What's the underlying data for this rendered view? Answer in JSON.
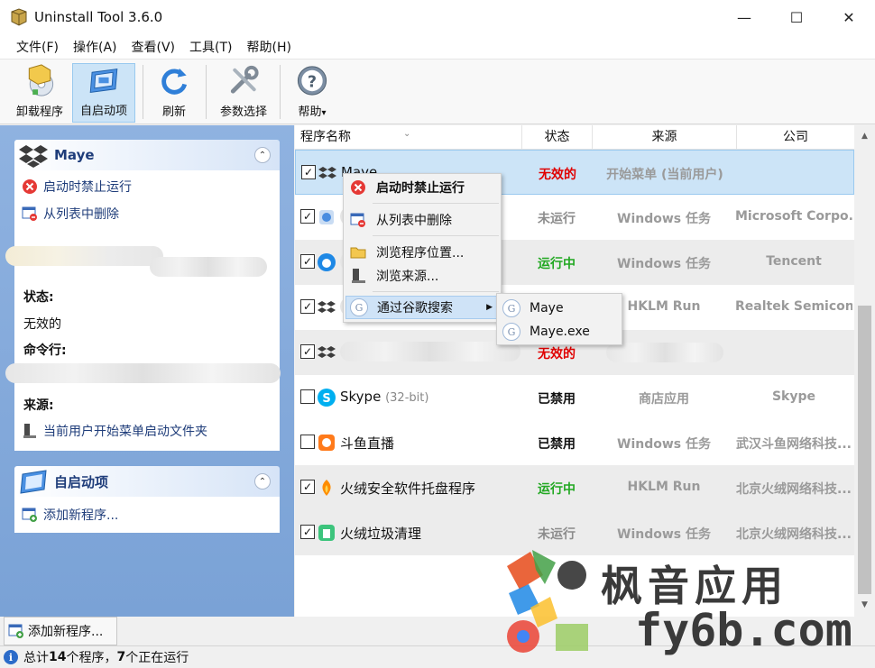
{
  "window": {
    "title": "Uninstall Tool 3.6.0",
    "minimize": "—",
    "maximize": "☐",
    "close": "✕"
  },
  "menu": [
    "文件(F)",
    "操作(A)",
    "查看(V)",
    "工具(T)",
    "帮助(H)"
  ],
  "toolbar": {
    "uninstall": "卸载程序",
    "autostart": "自启动项",
    "refresh": "刷新",
    "preferences": "参数选择",
    "help": "帮助",
    "help_arrow": "▾"
  },
  "left_panel": {
    "item_title": "Maye",
    "actions": {
      "disable_on_start": "启动时禁止运行",
      "remove_from_list": "从列表中删除"
    },
    "status_label": "状态:",
    "status_value": "无效的",
    "cmdline_label": "命令行:",
    "source_label": "来源:",
    "source_value": "当前用户开始菜单启动文件夹",
    "autostart_section_title": "自启动项",
    "add_new_program": "添加新程序..."
  },
  "list": {
    "columns": [
      "程序名称",
      "状态",
      "来源",
      "公司"
    ],
    "rows": [
      {
        "checked": true,
        "name": "Maye",
        "sub": "",
        "status": "无效的",
        "status_kind": "invalid",
        "source": "开始菜单 (当前用户)",
        "company": ""
      },
      {
        "checked": true,
        "name": "",
        "sub": "",
        "status": "未运行",
        "status_kind": "stopped",
        "source": "Windows 任务",
        "company": "Microsoft Corpo..."
      },
      {
        "checked": true,
        "name": "",
        "sub": "",
        "status": "运行中",
        "status_kind": "running",
        "source": "Windows 任务",
        "company": "Tencent"
      },
      {
        "checked": true,
        "name": "",
        "sub": "",
        "status": "",
        "status_kind": "stopped",
        "source": "HKLM Run",
        "company": "Realtek Semicon..."
      },
      {
        "checked": true,
        "name": "",
        "sub": "",
        "status": "无效的",
        "status_kind": "invalid",
        "source": "",
        "company": ""
      },
      {
        "checked": false,
        "name": "Skype",
        "sub": "(32-bit)",
        "status": "已禁用",
        "status_kind": "disabled",
        "source": "商店应用",
        "company": "Skype"
      },
      {
        "checked": false,
        "name": "斗鱼直播",
        "sub": "",
        "status": "已禁用",
        "status_kind": "disabled",
        "source": "Windows 任务",
        "company": "武汉斗鱼网络科技..."
      },
      {
        "checked": true,
        "name": "火绒安全软件托盘程序",
        "sub": "",
        "status": "运行中",
        "status_kind": "running",
        "source": "HKLM Run",
        "company": "北京火绒网络科技..."
      },
      {
        "checked": true,
        "name": "火绒垃圾清理",
        "sub": "",
        "status": "未运行",
        "status_kind": "stopped",
        "source": "Windows 任务",
        "company": "北京火绒网络科技..."
      }
    ]
  },
  "context_menu": {
    "disable_on_start": "启动时禁止运行",
    "remove_from_list": "从列表中删除",
    "browse_location": "浏览程序位置...",
    "browse_source": "浏览来源...",
    "google_search": "通过谷歌搜索",
    "submenu": [
      "Maye",
      "Maye.exe"
    ]
  },
  "bottom": {
    "add_new_program": "添加新程序...",
    "status_prefix": "总计 ",
    "total": "14",
    "status_mid": " 个程序，",
    "running": "7",
    "status_suffix": " 个正在运行"
  },
  "watermark": {
    "line1": "枫音应用",
    "line2": "fy6b.com"
  },
  "colors": {
    "selected_row": "#cce4f7",
    "invalid": "#e00000",
    "running": "#22a822",
    "panel_blue": "#7aa2d6"
  }
}
